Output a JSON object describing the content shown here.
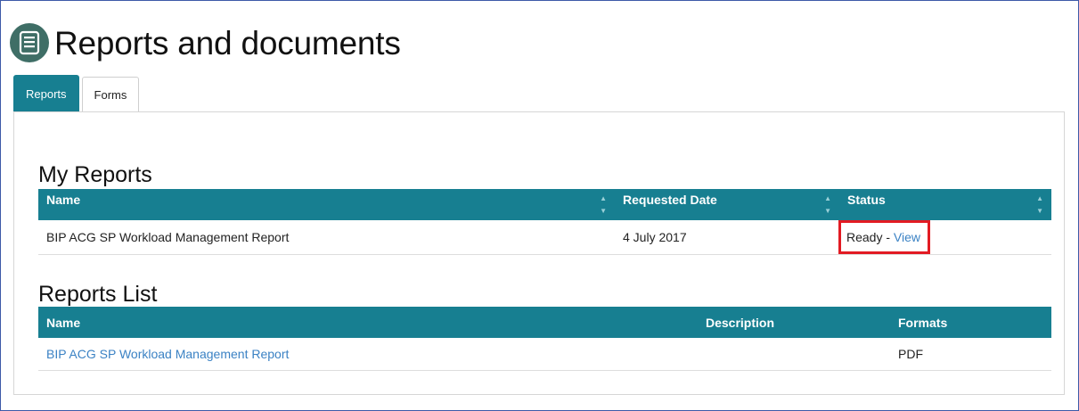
{
  "page": {
    "title": "Reports and documents"
  },
  "tabs": [
    {
      "label": "Reports",
      "active": true
    },
    {
      "label": "Forms",
      "active": false
    }
  ],
  "my_reports": {
    "title": "My Reports",
    "columns": [
      "Name",
      "Requested Date",
      "Status"
    ],
    "rows": [
      {
        "name": "BIP ACG SP Workload Management Report",
        "date": "4 July 2017",
        "status": "Ready",
        "separator": " - ",
        "action": "View"
      }
    ]
  },
  "reports_list": {
    "title": "Reports List",
    "columns": [
      "Name",
      "Description",
      "Formats"
    ],
    "rows": [
      {
        "name": "BIP ACG SP Workload Management Report",
        "description": "",
        "format": "PDF"
      }
    ]
  },
  "colors": {
    "accent": "#177f91",
    "link": "#3b82c4",
    "highlight": "#e21b23",
    "icon_bg": "#3f6e66"
  }
}
